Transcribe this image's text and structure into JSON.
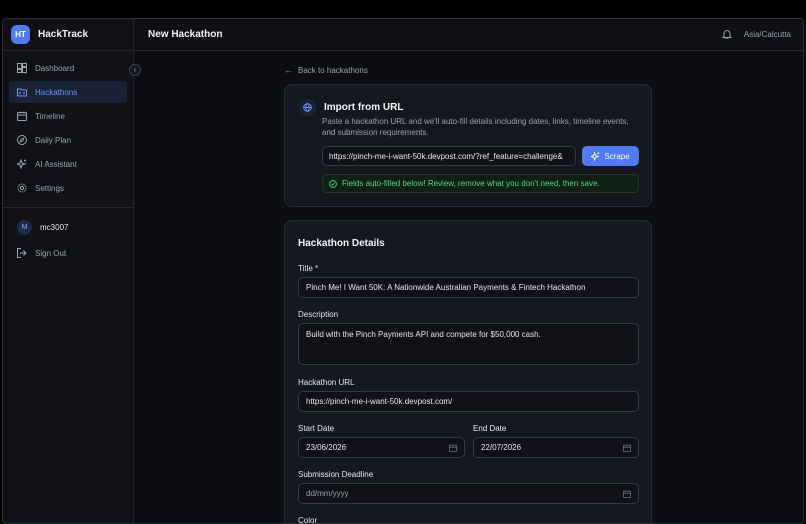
{
  "app": {
    "logo_text": "HT",
    "name": "HackTrack"
  },
  "header": {
    "title": "New Hackathon",
    "timezone": "Asia/Calcutta",
    "bell_icon": "bell-icon"
  },
  "sidebar": {
    "items": [
      {
        "label": "Dashboard",
        "icon": "dashboard-icon",
        "active": false
      },
      {
        "label": "Hackathons",
        "icon": "folder-code-icon",
        "active": true
      },
      {
        "label": "Timeline",
        "icon": "calendar-icon",
        "active": false
      },
      {
        "label": "Daily Plan",
        "icon": "compass-icon",
        "active": false
      },
      {
        "label": "AI Assistant",
        "icon": "sparkles-icon",
        "active": false
      },
      {
        "label": "Settings",
        "icon": "gear-icon",
        "active": false
      }
    ],
    "user": {
      "initial": "M",
      "name": "mc3007"
    },
    "sign_out": "Sign Out"
  },
  "main": {
    "back_link": "Back to hackathons",
    "import": {
      "title": "Import from URL",
      "description": "Paste a hackathon URL and we'll auto-fill details including dates, links, timeline events, and submission requirements.",
      "url_value": "https://pinch-me-i-want-50k.devpost.com/?ref_feature=challenge&",
      "scrape_label": "Scrape",
      "success_message": "Fields auto-filled below! Review, remove what you don't need, then save."
    },
    "details": {
      "title": "Hackathon Details",
      "title_label": "Title *",
      "title_value": "Pinch Me! I Want 50K: A Nationwide Australian Payments & Fintech Hackathon",
      "description_label": "Description",
      "description_value": "Build with the Pinch Payments API and compete for $50,000 cash.",
      "url_label": "Hackathon URL",
      "url_value": "https://pinch-me-i-want-50k.devpost.com/",
      "start_label": "Start Date",
      "start_value": "23/06/2026",
      "end_label": "End Date",
      "end_value": "22/07/2026",
      "deadline_label": "Submission Deadline",
      "deadline_placeholder": "dd/mm/yyyy",
      "color_label": "Color"
    }
  },
  "colors": {
    "accent": "#4f7cf5",
    "active_nav_bg": "#1b2236",
    "success": "#4ade80"
  }
}
